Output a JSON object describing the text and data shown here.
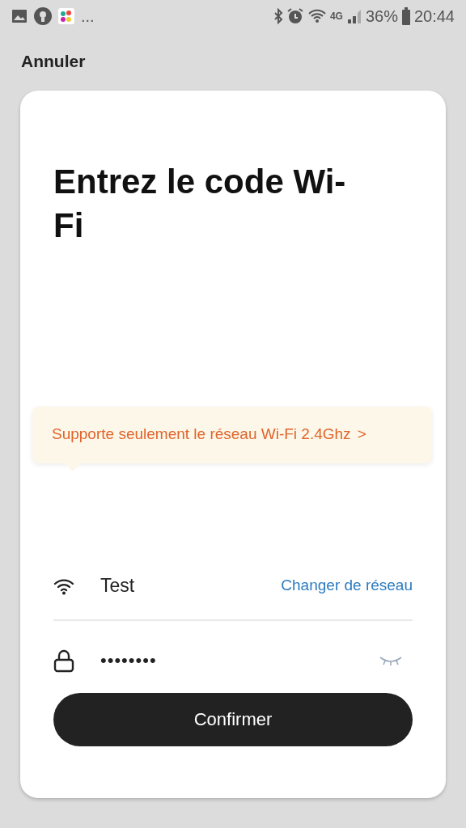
{
  "status_bar": {
    "more": "...",
    "network": "4G",
    "battery": "36%",
    "time": "20:44"
  },
  "cancel": "Annuler",
  "title": "Entrez le code Wi-Fi",
  "notice": {
    "text": "Supporte seulement le réseau Wi-Fi 2.4Ghz",
    "chevron": ">"
  },
  "network": {
    "name": "Test",
    "change": "Changer de réseau"
  },
  "password": {
    "value": "••••••••",
    "visible": false
  },
  "confirm": "Confirmer"
}
